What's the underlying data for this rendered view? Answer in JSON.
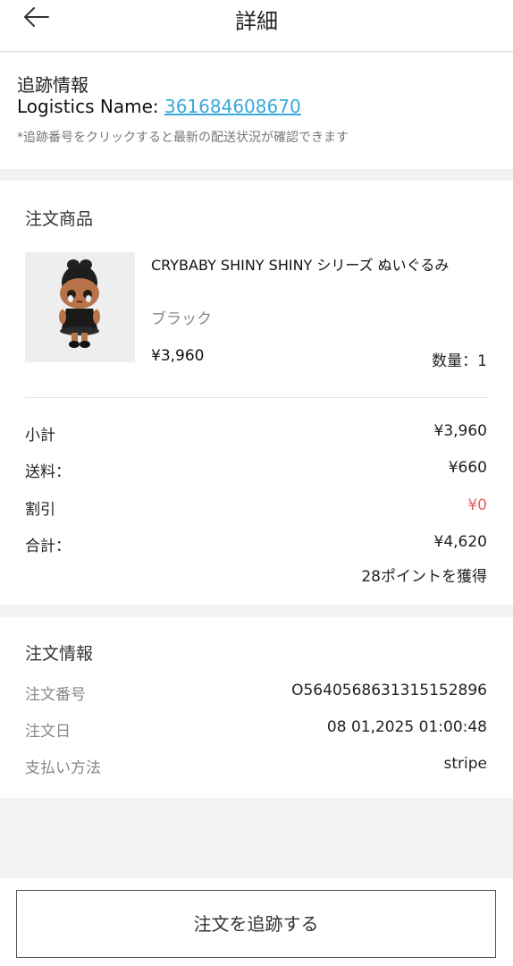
{
  "header": {
    "title": "詳細",
    "back_icon": "arrow-left-icon"
  },
  "tracking": {
    "title": "追跡情報",
    "logistics_label": "Logistics Name: ",
    "tracking_number": "361684608670",
    "note": "*追跡番号をクリックすると最新の配送状況が確認できます"
  },
  "order_items": {
    "title": "注文商品",
    "product": {
      "name": "CRYBABY SHINY SHINY シリーズ ぬいぐるみ",
      "variant": "ブラック",
      "price": "¥3,960",
      "quantity": "数量：1"
    },
    "summary": [
      {
        "label": "小計",
        "value": "¥3,960"
      },
      {
        "label": "送料：",
        "value": "¥660"
      },
      {
        "label": "割引",
        "value": "¥0"
      },
      {
        "label": "合計：",
        "value": "¥4,620"
      }
    ],
    "points": "28ポイントを獲得",
    "discount_color": "#e0605e"
  },
  "order_info": {
    "title": "注文情報",
    "rows": [
      {
        "label": "注文番号",
        "value": "O564056863131515289б"
      },
      {
        "label": "注文日",
        "value": "08 01,2025 01:00:48"
      },
      {
        "label": "支払い方法",
        "value": "stripe"
      }
    ]
  },
  "footer": {
    "track_button": "注文を追跡する"
  },
  "colors": {
    "link": "#3aa8d8",
    "background": "#f2f2f2"
  }
}
